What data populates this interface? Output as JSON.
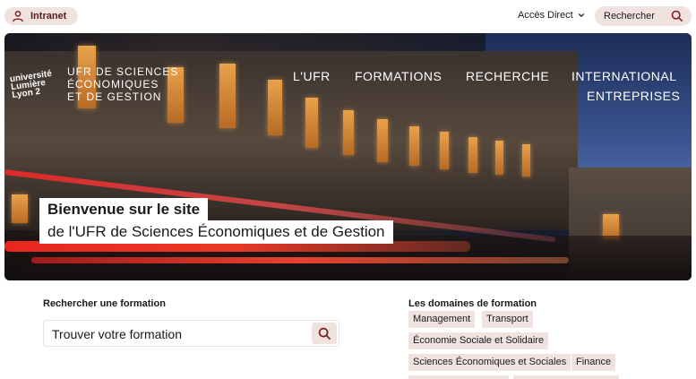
{
  "topbar": {
    "intranet_label": "Intranet",
    "acces_label": "Accès Direct",
    "search_label": "Rechercher"
  },
  "hero": {
    "logo_text_1": "université",
    "logo_text_2": "Lumière",
    "logo_text_3": "Lyon 2",
    "ufr_line1": "UFR DE SCIENCES",
    "ufr_line2": "ÉCONOMIQUES",
    "ufr_line3": "ET DE GESTION",
    "nav": [
      "L'UFR",
      "FORMATIONS",
      "RECHERCHE",
      "INTERNATIONAL",
      "ENTREPRISES"
    ],
    "welcome_line1": "Bienvenue sur le site",
    "welcome_line2": "de l'UFR de Sciences Économiques et de Gestion"
  },
  "formation_search": {
    "title": "Rechercher une formation",
    "placeholder": "Trouver votre formation"
  },
  "domains": {
    "title": "Les domaines de formation",
    "tags": [
      "Management",
      "Transport",
      "Économie Sociale et Solidaire",
      "Sciences Économiques et Sociales",
      "Finance"
    ]
  },
  "colors": {
    "accent_bg": "#efe2df",
    "accent_text": "#5a1a1a"
  }
}
